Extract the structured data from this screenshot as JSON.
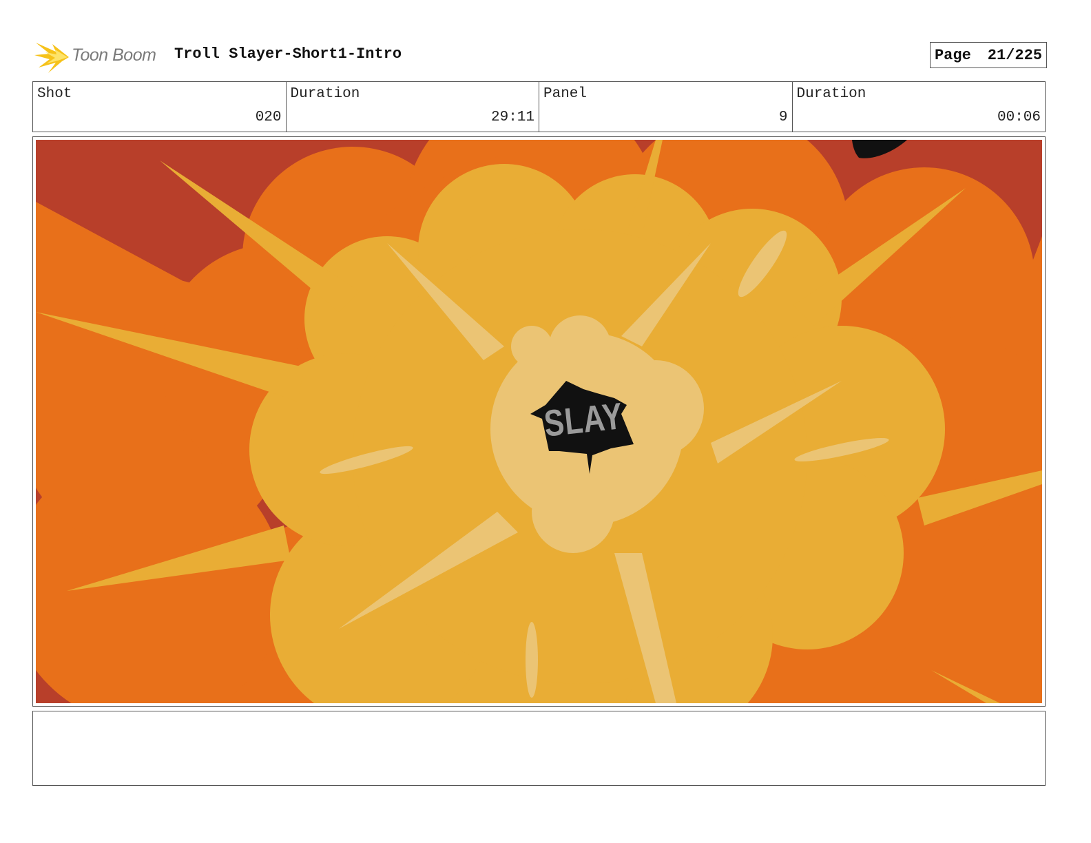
{
  "header": {
    "logo_text": "Toon Boom",
    "project_title": "Troll Slayer-Short1-Intro",
    "page_label": "Page",
    "page_value": "21/225"
  },
  "info": {
    "shot_label": "Shot",
    "shot_value": "020",
    "shot_duration_label": "Duration",
    "shot_duration_value": "29:11",
    "panel_label": "Panel",
    "panel_value": "9",
    "panel_duration_label": "Duration",
    "panel_duration_value": "00:06"
  },
  "panel": {
    "sound_effect_text": "SLAY",
    "colors": {
      "background_dark": "#b83f2a",
      "burst_orange": "#e8701a",
      "burst_yellow": "#e9ad35",
      "core_light": "#ebc474",
      "center_black": "#111111",
      "lettering_grey": "#9a9a9a"
    }
  },
  "notes": {
    "text": ""
  }
}
